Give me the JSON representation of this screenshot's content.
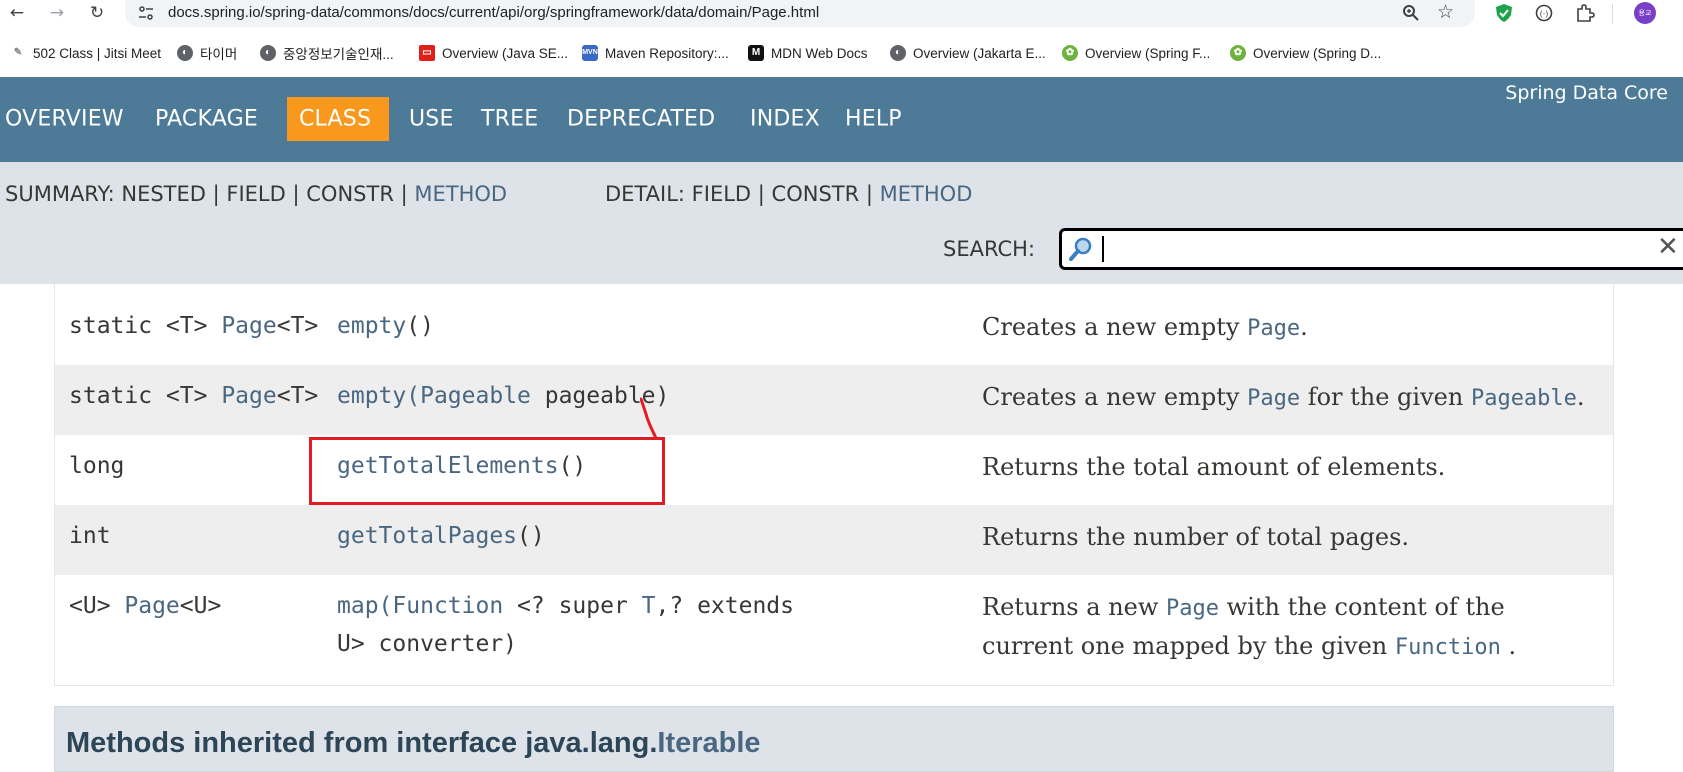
{
  "browser": {
    "url": "docs.spring.io/spring-data/commons/docs/current/api/org/springframework/data/domain/Page.html",
    "avatar_text": "용교",
    "bookmarks": [
      {
        "label": "502 Class | Jitsi Meet",
        "icon": "jitsi-icon"
      },
      {
        "label": "타이머",
        "icon": "globe-icon"
      },
      {
        "label": "중앙정보기술인재...",
        "icon": "globe-icon"
      },
      {
        "label": "Overview (Java SE...",
        "icon": "oracle-icon"
      },
      {
        "label": "Maven Repository:...",
        "icon": "maven-icon"
      },
      {
        "label": "MDN Web Docs",
        "icon": "mdn-icon"
      },
      {
        "label": "Overview (Jakarta E...",
        "icon": "globe-icon"
      },
      {
        "label": "Overview (Spring F...",
        "icon": "spring-icon"
      },
      {
        "label": "Overview (Spring D...",
        "icon": "spring-icon"
      }
    ]
  },
  "javadoc": {
    "brand": "Spring Data Core",
    "nav": [
      "OVERVIEW",
      "PACKAGE",
      "CLASS",
      "USE",
      "TREE",
      "DEPRECATED",
      "INDEX",
      "HELP"
    ],
    "active_nav": "CLASS",
    "summary": {
      "label": "SUMMARY:",
      "nested": "NESTED",
      "field": "FIELD",
      "constr": "CONSTR",
      "method": "METHOD",
      "sep": "|"
    },
    "detail": {
      "label": "DETAIL:",
      "field": "FIELD",
      "constr": "CONSTR",
      "method": "METHOD"
    },
    "search_label": "SEARCH:",
    "search_value": "",
    "colors": {
      "nav_bg": "#4d7a97",
      "active_bg": "#f8981d",
      "subnav_bg": "#dee3e9",
      "link": "#4a6782",
      "highlight": "#e51b24"
    }
  },
  "methods": [
    {
      "modifier_prefix": "static <T> ",
      "modifier_link": "Page",
      "modifier_suffix": "<T>",
      "name": "empty",
      "params": "()",
      "desc_pre": "Creates a new empty ",
      "desc_link": "Page",
      "desc_post": "."
    },
    {
      "modifier_prefix": "static <T> ",
      "modifier_link": "Page",
      "modifier_suffix": "<T>",
      "name": "empty",
      "params_open": "(",
      "param_type": "Pageable",
      "param_name": " pageable)",
      "desc_pre": "Creates a new empty ",
      "desc_link": "Page",
      "desc_mid": " for the given ",
      "desc_link2": "Pageable",
      "desc_post": "."
    },
    {
      "modifier_prefix": "long",
      "name": "getTotalElements",
      "params": "()",
      "desc_pre": "Returns the total amount of elements."
    },
    {
      "modifier_prefix": "int",
      "name": "getTotalPages",
      "params": "()",
      "desc_pre": "Returns the number of total pages."
    },
    {
      "modifier_prefix": "<U> ",
      "modifier_link": "Page",
      "modifier_suffix": "<U>",
      "name": "map",
      "params_open": "(",
      "param_type": "Function",
      "param_rest1": " <? super ",
      "param_t": "T",
      "param_rest2": ",? extends",
      "param_line2": "U> converter)",
      "desc_pre": "Returns a new ",
      "desc_link": "Page",
      "desc_mid": " with the content of the",
      "desc_line2_pre": "current one mapped by the given ",
      "desc_link2": "Function",
      "desc_post": "  ."
    }
  ],
  "inherited": {
    "title_pre": "Methods inherited from interface java.lang.",
    "title_link": "Iterable"
  }
}
